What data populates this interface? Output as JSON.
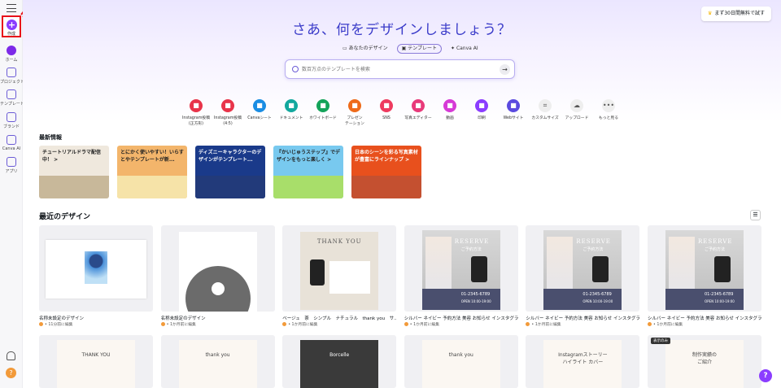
{
  "sidebar": {
    "create_label": "作成",
    "items": [
      {
        "label": "ホーム"
      },
      {
        "label": "プロジェクト"
      },
      {
        "label": "テンプレート"
      },
      {
        "label": "ブランド"
      },
      {
        "label": "Canva AI"
      },
      {
        "label": "アプリ"
      }
    ],
    "avatar_letter": "?"
  },
  "header": {
    "trial_button": "まず30日間無料で試す",
    "title": "さあ、何をデザインしましょう？",
    "tabs": [
      {
        "label": "あなたのデザイン"
      },
      {
        "label": "テンプレート"
      },
      {
        "label": "Canva AI"
      }
    ],
    "search_placeholder": "数百万点のテンプレートを検索"
  },
  "quick_actions": [
    {
      "label": "Instagram投稿\n(正方形)",
      "color": "#e8344a",
      "icon": "instagram-icon"
    },
    {
      "label": "Instagram投稿\n(4:5)",
      "color": "#e8344a",
      "icon": "instagram-icon"
    },
    {
      "label": "Canvaシート",
      "color": "#1a8de3",
      "icon": "sheet-icon"
    },
    {
      "label": "ドキュメント",
      "color": "#13a89e",
      "icon": "doc-icon"
    },
    {
      "label": "ホワイトボード",
      "color": "#14a35a",
      "icon": "whiteboard-icon"
    },
    {
      "label": "プレゼン\nテーション",
      "color": "#ee6a1a",
      "icon": "presentation-icon"
    },
    {
      "label": "SNS",
      "color": "#ee3b5f",
      "icon": "heart-icon"
    },
    {
      "label": "写真エディター",
      "color": "#e83a7a",
      "icon": "camera-icon"
    },
    {
      "label": "動画",
      "color": "#d63ad6",
      "icon": "video-icon"
    },
    {
      "label": "印刷",
      "color": "#8b3dff",
      "icon": "print-icon"
    },
    {
      "label": "Webサイト",
      "color": "#5b4bdf",
      "icon": "web-icon"
    },
    {
      "label": "カスタムサイズ",
      "color": "#eeeeee",
      "icon": "crop-icon"
    },
    {
      "label": "アップロード",
      "color": "#eeeeee",
      "icon": "upload-icon"
    },
    {
      "label": "もっと見る",
      "color": "#eeeeee",
      "icon": "more-icon"
    }
  ],
  "news": {
    "title": "最新情報",
    "cards": [
      {
        "text": "チュートリアルドラマ配信中！ >",
        "bg": "#efe8dd",
        "color": "#222"
      },
      {
        "text": "とにかく使いやすい！いらすとやテンプレートが新...",
        "bg": "#f3b56b",
        "color": "#222"
      },
      {
        "text": "ディズニーキャラクターのデザインがテンプレート...",
        "bg": "#1a3a8a",
        "color": "#ffffff"
      },
      {
        "text": "『かいじゅうステップ』でデザインをもっと楽しく >",
        "bg": "#78c9ef",
        "color": "#222"
      },
      {
        "text": "日本のシーンを彩る写真素材が豊富にラインナップ >",
        "bg": "#e8501d",
        "color": "#ffffff"
      }
    ]
  },
  "recent": {
    "title": "最近のデザイン",
    "designs": [
      {
        "name": "名称未設定のデザイン",
        "meta": "• 11分前に編集",
        "type": "photo"
      },
      {
        "name": "名称未設定のデザイン",
        "meta": "• 1か月前に編集",
        "type": "avatar"
      },
      {
        "name": "ベージュ　茶　シンプル　ナチュラル　thank you　サ...",
        "meta": "• 1か月前に編集",
        "type": "thankyou"
      },
      {
        "name": "シルバー ネイビー 予約方法 美容 お知らせ インスタグラ...",
        "meta": "• 1か月前に編集",
        "type": "reserve"
      },
      {
        "name": "シルバー ネイビー 予約方法 美容 お知らせ インスタグラ...",
        "meta": "• 1か月前に編集",
        "type": "reserve"
      },
      {
        "name": "シルバー ネイビー 予約方法 美容 お知らせ インスタグラ...",
        "meta": "• 1か月前に編集",
        "type": "reserve"
      }
    ],
    "reserve_title": "RESERVE",
    "reserve_sub": "ご予約方法",
    "reserve_phone": "01-2345-6789",
    "reserve_hours": "OPEN 10:00-19:00",
    "thankyou_title": "THANK YOU",
    "row2": [
      {
        "title": "THANK YOU"
      },
      {
        "title": "thank you"
      },
      {
        "title": "Borcelle"
      },
      {
        "title": "thank you"
      },
      {
        "title": "Instagramストーリー\nハイライト カバー"
      },
      {
        "title": "制作実績の\nご紹介",
        "badge": "表示のみ"
      }
    ]
  },
  "help_label": "?"
}
